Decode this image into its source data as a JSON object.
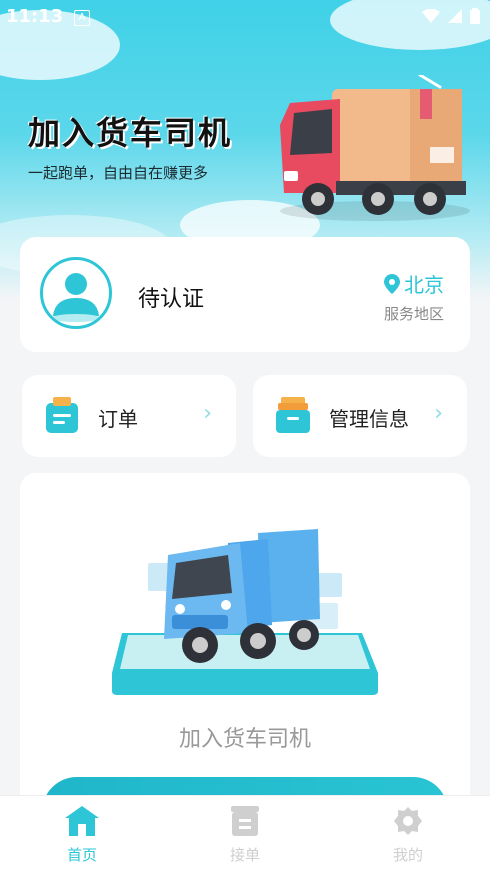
{
  "status_bar": {
    "time": "11:13",
    "notification_letter": "A"
  },
  "hero": {
    "title": "加入货车司机",
    "subtitle": "一起跑单，自由自在赚更多"
  },
  "profile": {
    "status": "待认证",
    "city": "北京",
    "city_label": "服务地区"
  },
  "menu": {
    "orders_label": "订单",
    "manage_label": "管理信息",
    "arrow": "›"
  },
  "join_card": {
    "caption": "加入货车司机"
  },
  "tabbar": {
    "tabs": [
      {
        "label": "首页",
        "icon": "home-icon",
        "active": true
      },
      {
        "label": "接单",
        "icon": "order-box-icon",
        "active": false
      },
      {
        "label": "我的",
        "icon": "gear-icon",
        "active": false
      }
    ]
  },
  "colors": {
    "accent": "#2ec6d6",
    "hero_top": "#3fd1e8",
    "truck_red": "#e84a5f",
    "truck_blue": "#4ea6ec",
    "inactive_tab": "#cfcfcf"
  }
}
